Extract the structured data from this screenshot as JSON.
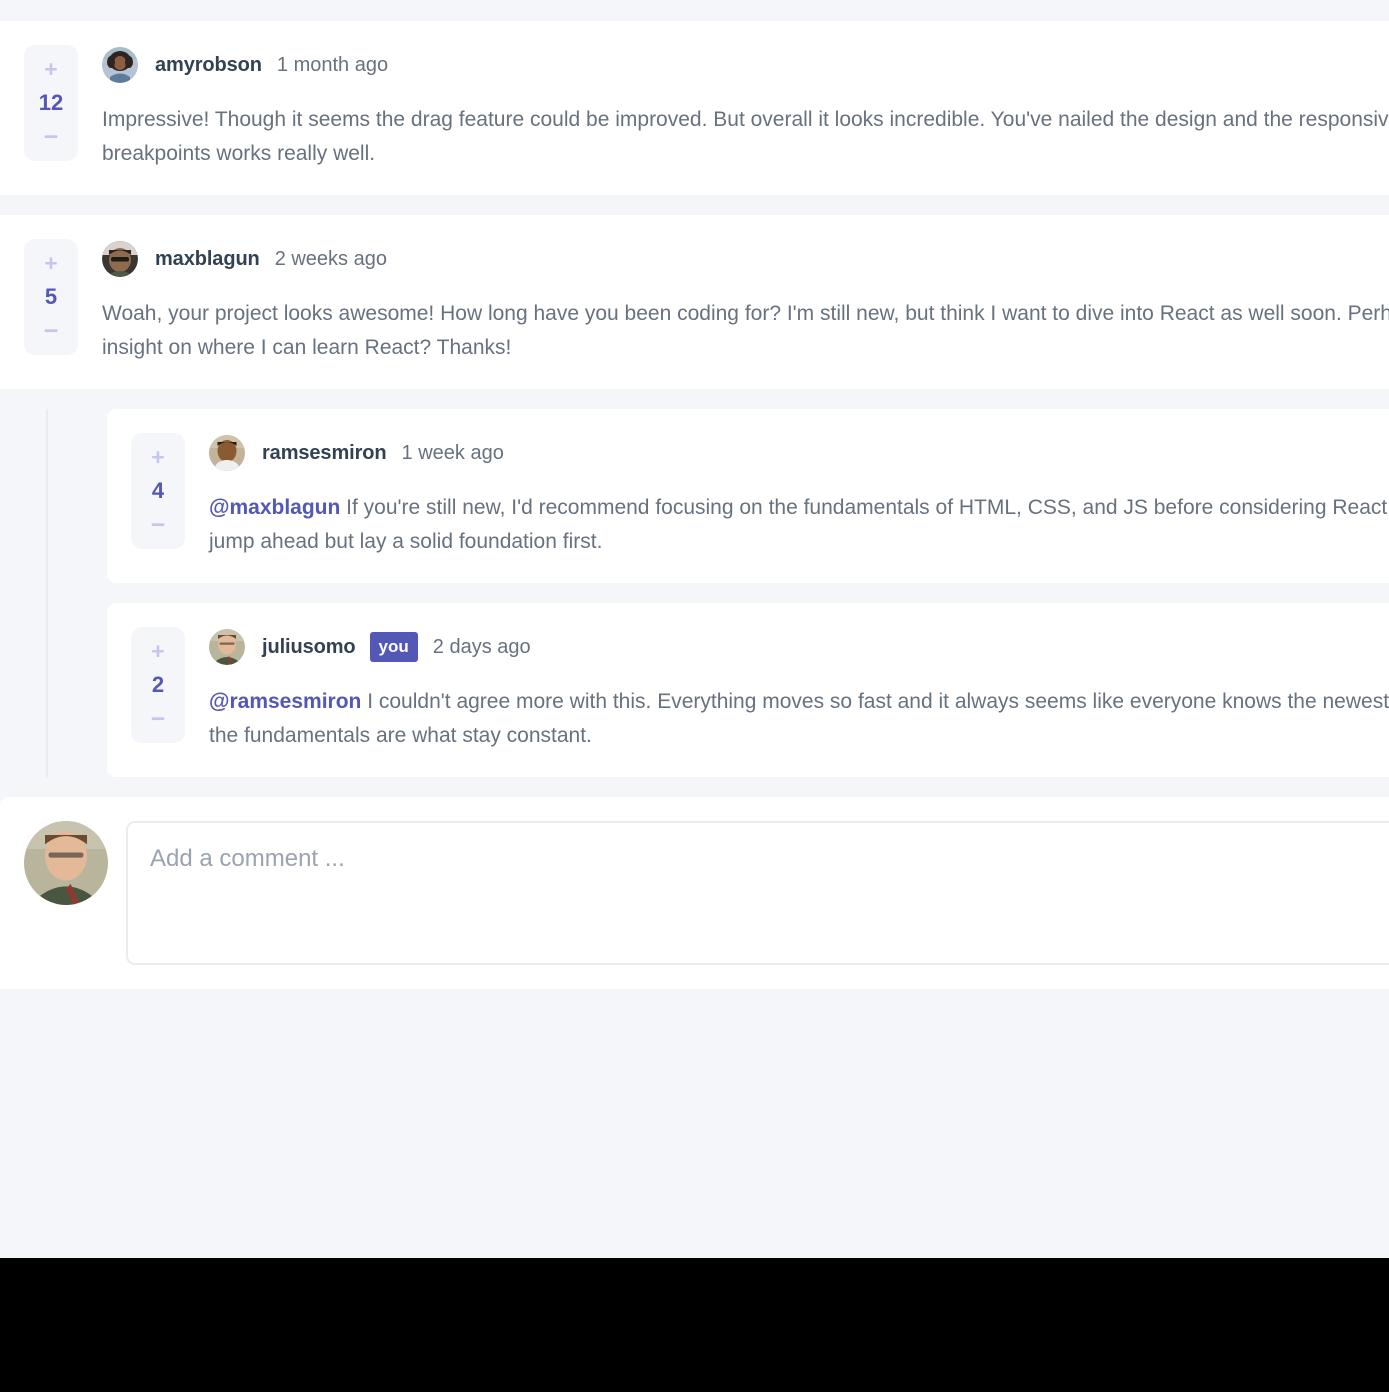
{
  "theme": {
    "page_bg": "#f5f6fa",
    "card_bg": "#ffffff",
    "accent": "#5357b6",
    "accent_light": "#c5c6ef",
    "username_color": "#334253",
    "body_text_color": "#67727e",
    "badge_bg": "#5357b6",
    "thread_line": "#e9ebf0"
  },
  "comments": [
    {
      "id": "c1",
      "username": "amyrobson",
      "timestamp": "1 month ago",
      "score": "12",
      "is_you": false,
      "avatar": "avatar-amyrobson",
      "mention": "",
      "content": "Impressive! Though it seems the drag feature could be improved. But overall it looks incredible. You've nailed the design and the responsiveness at various breakpoints works really well.",
      "replies": []
    },
    {
      "id": "c2",
      "username": "maxblagun",
      "timestamp": "2 weeks ago",
      "score": "5",
      "is_you": false,
      "avatar": "avatar-maxblagun",
      "mention": "",
      "content": "Woah, your project looks awesome! How long have you been coding for? I'm still new, but think I want to dive into React as well soon. Perhaps you can give me an insight on where I can learn React? Thanks!",
      "replies": [
        {
          "id": "c2r1",
          "username": "ramsesmiron",
          "timestamp": "1 week ago",
          "score": "4",
          "is_you": false,
          "avatar": "avatar-ramsesmiron",
          "mention": "@maxblagun",
          "content": " If you're still new, I'd recommend focusing on the fundamentals of HTML, CSS, and JS before considering React. It's very tempting to jump ahead but lay a solid foundation first."
        },
        {
          "id": "c2r2",
          "username": "juliusomo",
          "timestamp": "2 days ago",
          "score": "2",
          "is_you": true,
          "avatar": "avatar-juliusomo",
          "mention": "@ramsesmiron",
          "content": " I couldn't agree more with this. Everything moves so fast and it always seems like everyone knows the newest library/framework. But the fundamentals are what stay constant."
        }
      ]
    }
  ],
  "vote": {
    "plus_label": "+",
    "minus_label": "−",
    "plus_icon": "plus-icon",
    "minus_icon": "minus-icon"
  },
  "you_badge_label": "you",
  "add_comment": {
    "placeholder": "Add a comment ...",
    "value": "",
    "avatar": "avatar-juliusomo-current-user"
  }
}
